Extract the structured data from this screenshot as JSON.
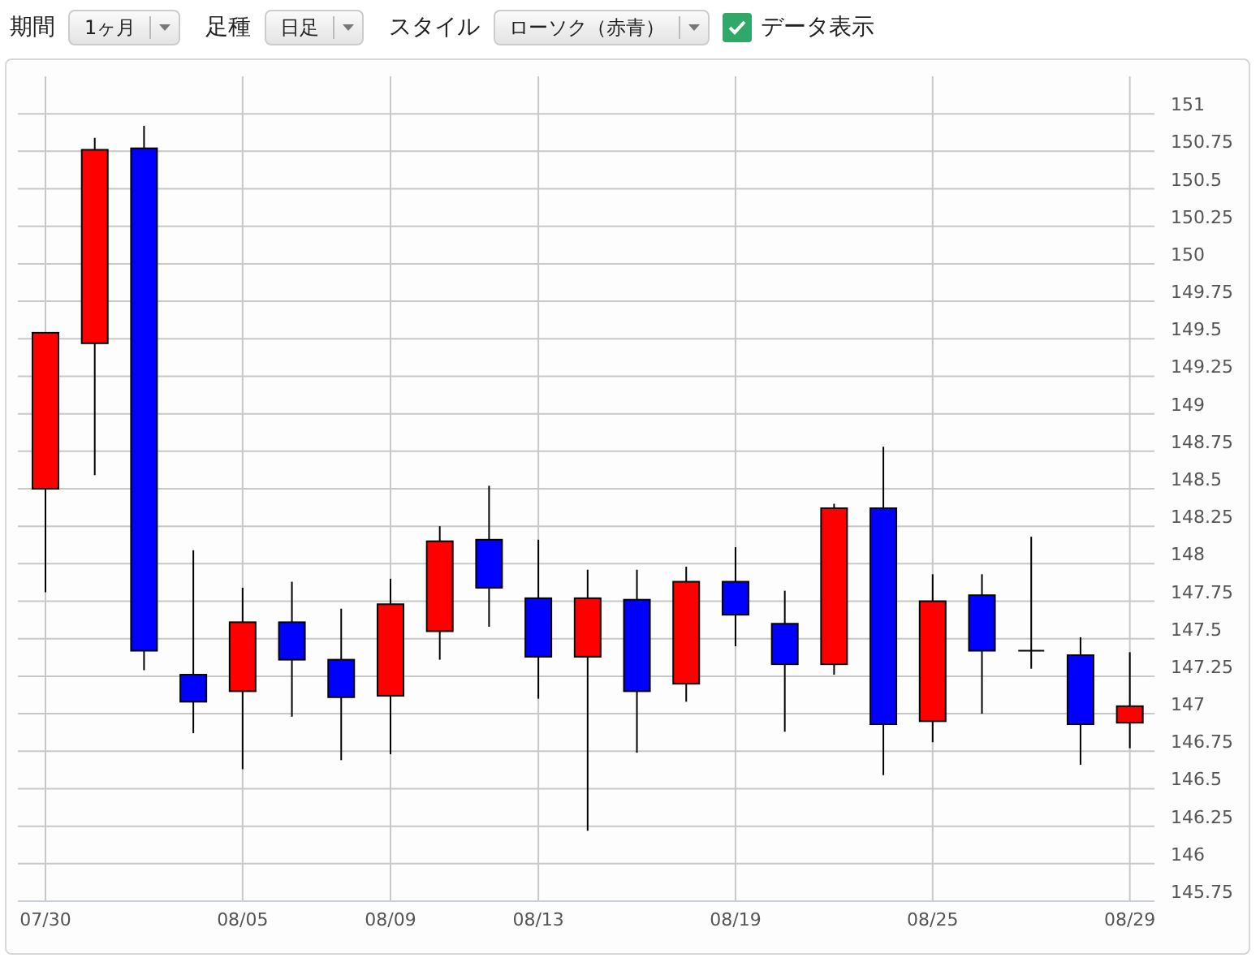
{
  "toolbar": {
    "period": {
      "label": "期間",
      "value": "1ヶ月"
    },
    "bar_type": {
      "label": "足種",
      "value": "日足"
    },
    "style": {
      "label": "スタイル",
      "value": "ローソク（赤青）"
    },
    "show_data": {
      "label": "データ表示",
      "checked": true
    }
  },
  "chart": {
    "chart_data": {
      "type": "candlestick",
      "categories": [
        "07/30",
        null,
        null,
        null,
        "08/05",
        null,
        null,
        "08/09",
        null,
        null,
        "08/13",
        null,
        null,
        null,
        "08/19",
        null,
        null,
        null,
        "08/25",
        null,
        null,
        null,
        "08/29"
      ],
      "ohlc": [
        [
          148.5,
          149.54,
          147.81,
          149.54
        ],
        [
          149.47,
          150.84,
          148.59,
          150.76
        ],
        [
          150.77,
          150.92,
          147.29,
          147.42
        ],
        [
          147.26,
          148.09,
          146.87,
          147.08
        ],
        [
          147.15,
          147.84,
          146.63,
          147.61
        ],
        [
          147.61,
          147.88,
          146.98,
          147.36
        ],
        [
          147.36,
          147.7,
          146.69,
          147.11
        ],
        [
          147.12,
          147.9,
          146.73,
          147.73
        ],
        [
          147.55,
          148.25,
          147.36,
          148.15
        ],
        [
          148.16,
          148.52,
          147.58,
          147.84
        ],
        [
          147.77,
          148.16,
          147.1,
          147.38
        ],
        [
          147.38,
          147.96,
          146.22,
          147.77
        ],
        [
          147.76,
          147.96,
          146.74,
          147.15
        ],
        [
          147.2,
          147.98,
          147.08,
          147.88
        ],
        [
          147.88,
          148.11,
          147.45,
          147.66
        ],
        [
          147.6,
          147.82,
          146.88,
          147.33
        ],
        [
          147.33,
          148.4,
          147.26,
          148.37
        ],
        [
          148.37,
          148.78,
          146.59,
          146.93
        ],
        [
          146.95,
          147.93,
          146.81,
          147.75
        ],
        [
          147.79,
          147.93,
          147,
          147.42
        ],
        [
          147.42,
          148.18,
          147.3,
          147.42
        ],
        [
          147.39,
          147.51,
          146.66,
          146.93
        ],
        [
          146.94,
          147.41,
          146.77,
          147.05
        ]
      ],
      "grid": true,
      "ylim": [
        145.75,
        151.25
      ],
      "yticks": [
        145.75,
        146,
        146.25,
        146.5,
        146.75,
        147,
        147.25,
        147.5,
        147.75,
        148,
        148.25,
        148.5,
        148.75,
        149,
        149.25,
        149.5,
        149.75,
        150,
        150.25,
        150.5,
        150.75,
        151
      ]
    }
  }
}
